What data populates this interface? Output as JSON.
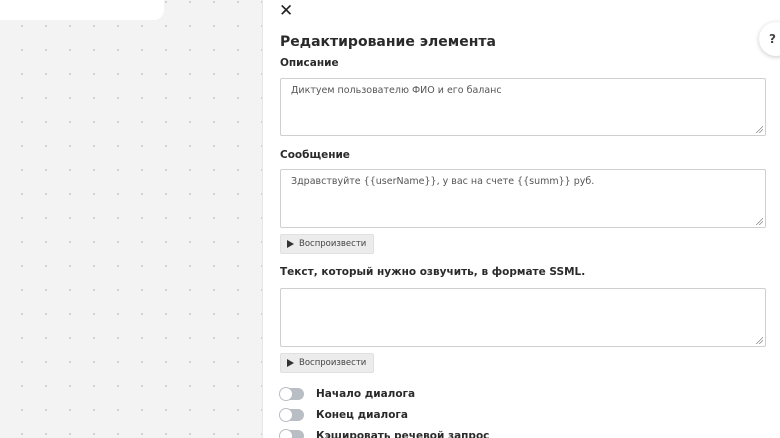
{
  "editor": {
    "title": "Редактирование элемента",
    "close_label": "✕",
    "help_label": "?",
    "description": {
      "label": "Описание",
      "value": "Диктуем пользователю ФИО и его баланс"
    },
    "message": {
      "label": "Сообщение",
      "value": "Здравствуйте {{userName}}, у вас на счете {{summ}} руб.",
      "play_label": "Воспроизвести"
    },
    "ssml": {
      "label": "Текст, который нужно озвучить, в формате SSML.",
      "value": "",
      "play_label": "Воспроизвести"
    },
    "toggles": [
      {
        "label": "Начало диалога",
        "checked": false
      },
      {
        "label": "Конец диалога",
        "checked": false
      },
      {
        "label": "Кэшировать речевой запрос",
        "checked": false
      }
    ]
  },
  "icons": {
    "close": "close-icon",
    "help": "question-icon",
    "play": "play-icon"
  },
  "colors": {
    "panel_background": "#ffffff",
    "canvas_background": "#f3f3f3",
    "toggle_off": "#b9bdc4"
  }
}
